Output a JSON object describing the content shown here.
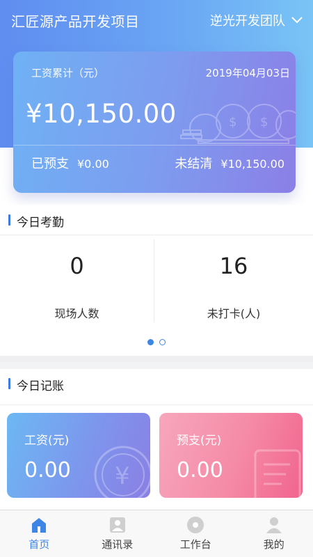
{
  "header": {
    "project_title": "汇匠源产品开发项目",
    "team_name": "逆光开发团队"
  },
  "salary_card": {
    "label": "工资累计（元）",
    "date": "2019年04月03日",
    "amount": "¥10,150.00",
    "prepaid_label": "已预支",
    "prepaid_value": "¥0.00",
    "unsettled_label": "未结清",
    "unsettled_value": "¥10,150.00"
  },
  "attendance": {
    "section_title": "今日考勤",
    "onsite_count": "0",
    "onsite_label": "现场人数",
    "unclocked_count": "16",
    "unclocked_label": "未打卡(人)",
    "page_indicator": {
      "pages": 2,
      "current": 1
    }
  },
  "accounting": {
    "section_title": "今日记账",
    "wage_label": "工资(元)",
    "wage_value": "0.00",
    "advance_label": "预支(元)",
    "advance_value": "0.00"
  },
  "tabs": [
    {
      "label": "首页",
      "icon": "home-icon",
      "active": true
    },
    {
      "label": "通讯录",
      "icon": "contacts-icon",
      "active": false
    },
    {
      "label": "工作台",
      "icon": "workbench-icon",
      "active": false
    },
    {
      "label": "我的",
      "icon": "profile-icon",
      "active": false
    }
  ],
  "colors": {
    "accent": "#3d86e6",
    "wage_card": "#7f93ec",
    "advance_card": "#f58aa6"
  }
}
